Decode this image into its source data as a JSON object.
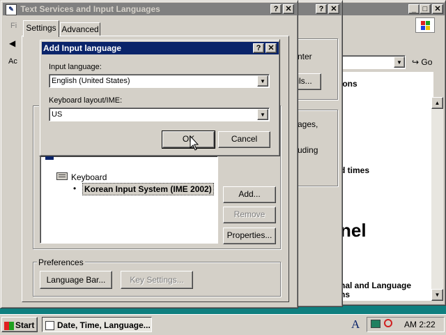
{
  "text_services_dialog": {
    "title": "Text Services and Input Languages",
    "tabs": [
      "Settings",
      "Advanced"
    ],
    "keyboard_group_label": "Keyboard",
    "installed_service": "Korean Input System (IME 2002)",
    "buttons": {
      "add": "Add...",
      "remove": "Remove",
      "properties": "Properties..."
    },
    "preferences": {
      "legend": "Preferences",
      "language_bar": "Language Bar...",
      "key_settings": "Key Settings..."
    }
  },
  "add_input_language_dialog": {
    "title": "Add Input language",
    "input_language_label": "Input language:",
    "input_language_value": "English (United States)",
    "keyboard_layout_label": "Keyboard layout/IME:",
    "keyboard_layout_value": "US",
    "ok": "OK",
    "cancel": "Cancel"
  },
  "background_dialog": {
    "partial_texts": [
      "nter",
      "ils...",
      "ages,",
      "uding"
    ]
  },
  "browser_window": {
    "go_label": "Go",
    "address_label": "Ac",
    "file_menu": "Fi",
    "partial_texts": [
      "ions",
      "d times",
      "nel",
      "nal and Language",
      "ns"
    ]
  },
  "taskbar": {
    "start": "Start",
    "task": "Date, Time, Language...",
    "clock": "AM 2:22",
    "ime_indicator": "A"
  },
  "icons": [
    "help-icon",
    "close-icon",
    "minimize-icon",
    "maximize-icon",
    "keyboard-icon",
    "windows-logo-icon",
    "go-arrow-icon",
    "scroll-up-icon",
    "scroll-down-icon",
    "ime-icon",
    "printer-tray-icon",
    "cursor-icon"
  ]
}
